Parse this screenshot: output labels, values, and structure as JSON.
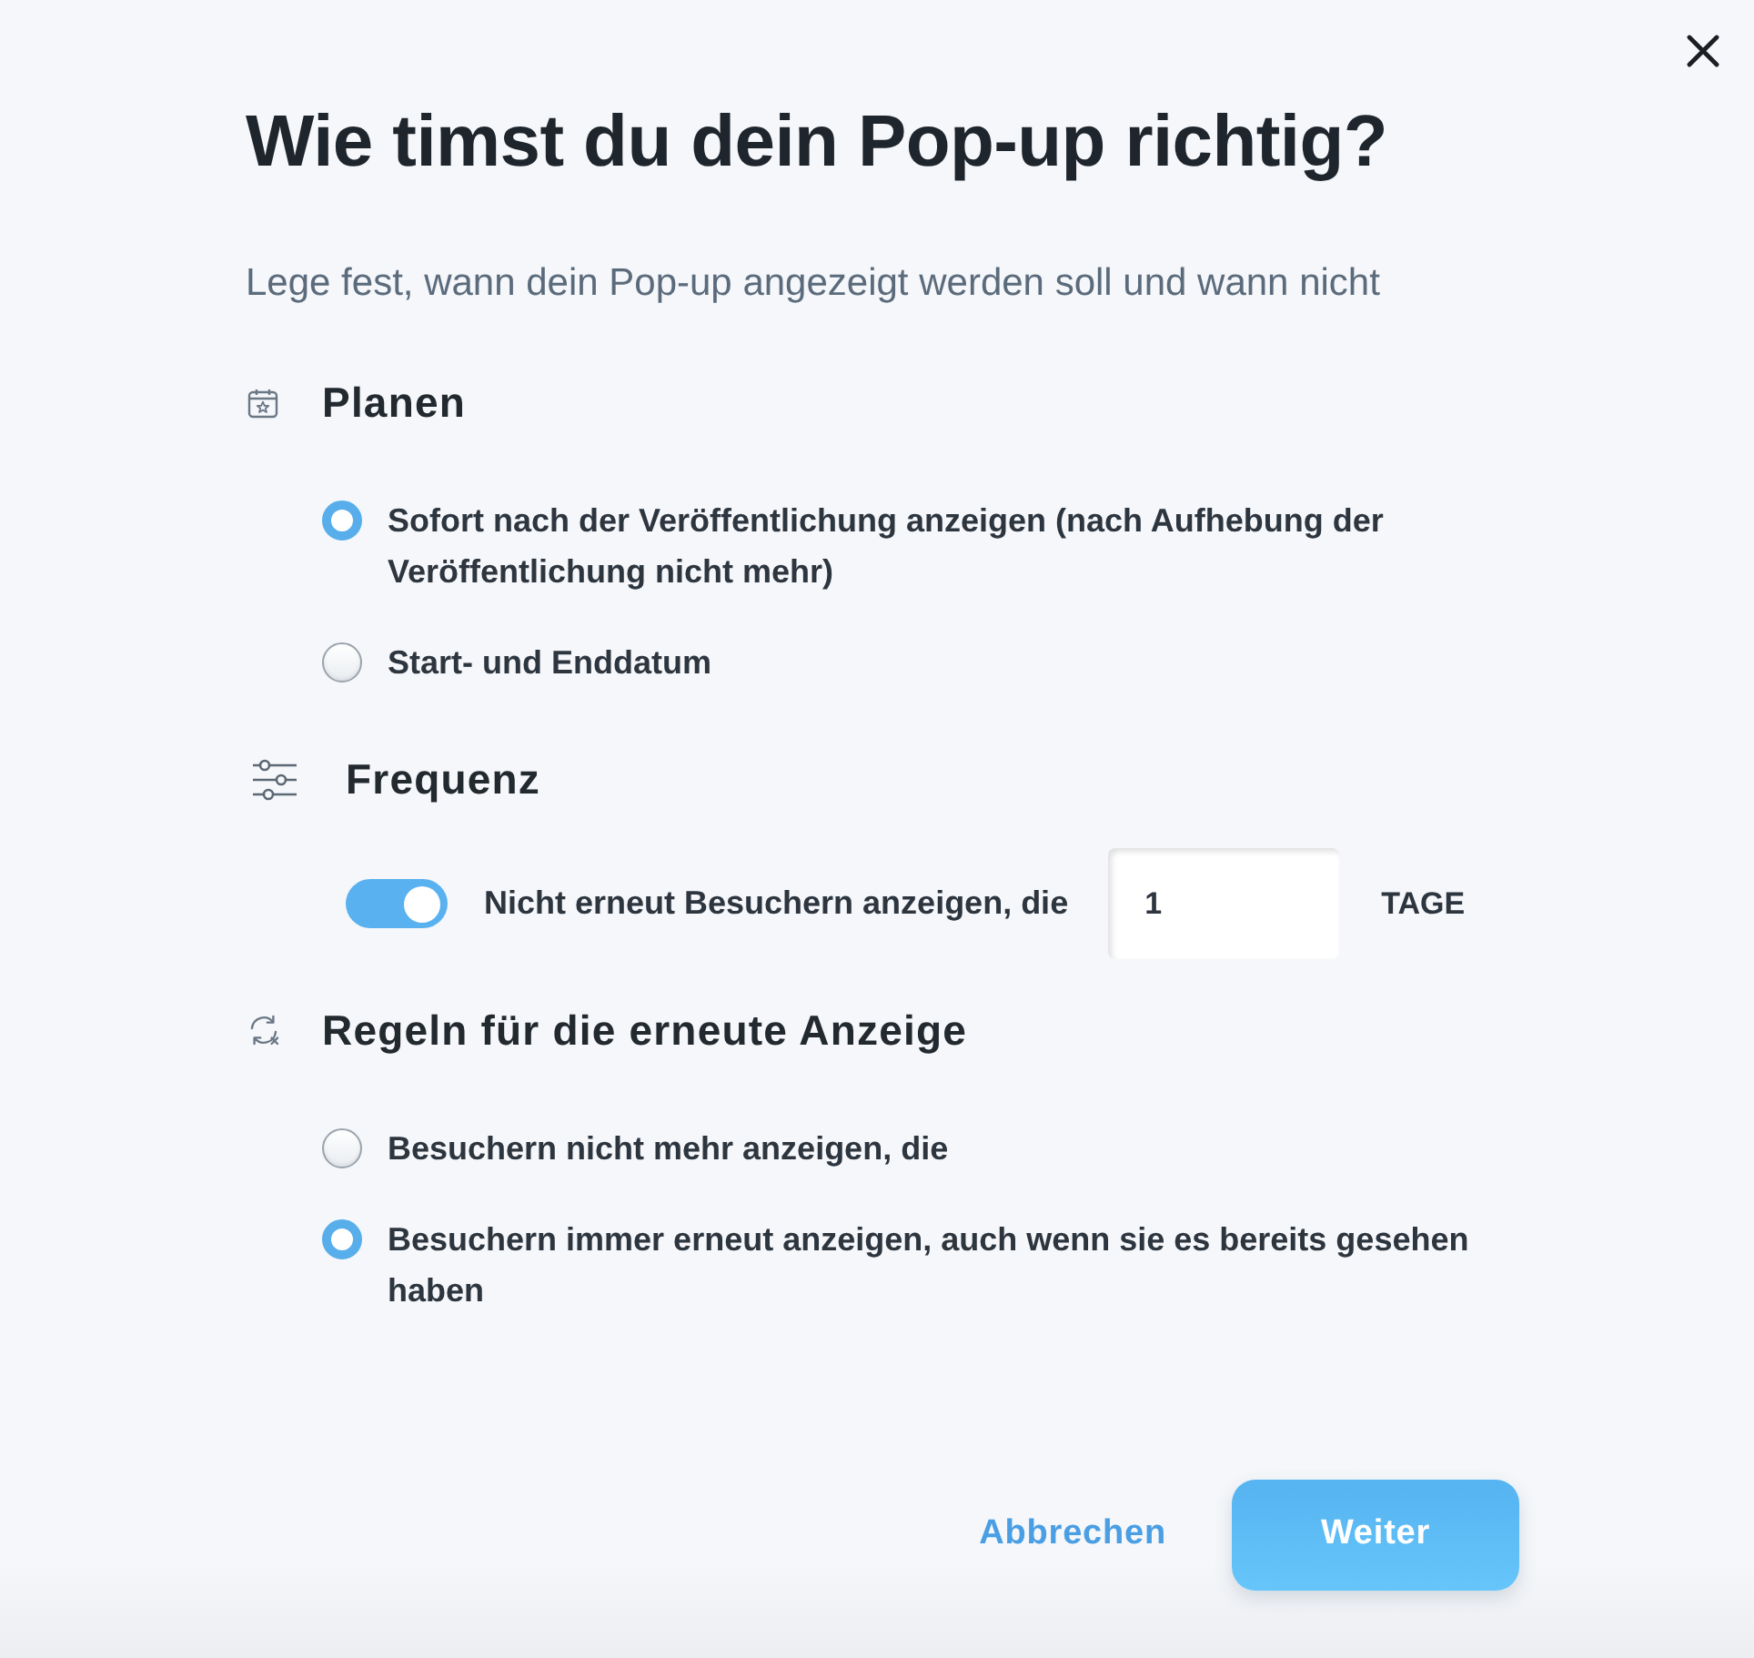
{
  "title": "Wie timst du dein Pop-up richtig?",
  "subtitle": "Lege fest, wann dein Pop-up angezeigt werden soll und wann nicht",
  "sections": [
    {
      "kind": "radio",
      "title": "Planen",
      "options": [
        {
          "label": "Sofort nach der Veröffentlichung anzeigen (nach Aufhebung der Veröffentlichung nicht mehr)",
          "selected": true
        },
        {
          "label": "Start- und Enddatum",
          "selected": false
        }
      ]
    },
    {
      "kind": "toggle",
      "title": "Frequenz",
      "toggle": {
        "on": true,
        "label": "Nicht erneut Besuchern anzeigen, die",
        "value": "1",
        "unit": "TAGE"
      }
    },
    {
      "kind": "radio",
      "title": "Regeln für die erneute Anzeige",
      "options": [
        {
          "label": "Besuchern nicht mehr anzeigen, die",
          "selected": false
        },
        {
          "label": "Besuchern immer erneut anzeigen, auch wenn sie es bereits gesehen haben",
          "selected": true
        }
      ]
    }
  ],
  "buttons": [
    {
      "kind": "link",
      "label": "Abbrechen"
    },
    {
      "kind": "primary",
      "label": "Weiter"
    }
  ]
}
